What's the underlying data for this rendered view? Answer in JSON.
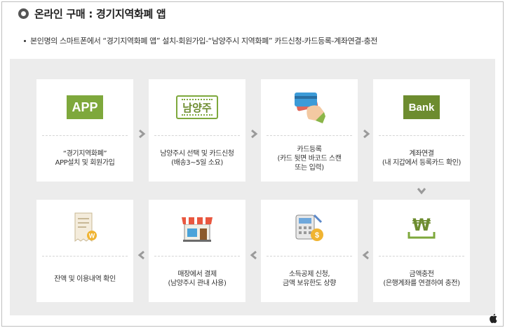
{
  "header": {
    "title": "온라인 구매 : 경기지역화폐 앱"
  },
  "description": "본인명의 스마트폰에서 “경기지역화폐 앱” 설치-회원가입-“남양주시 지역화폐” 카드신청-카드등록-계좌연결-충전",
  "icons": {
    "app_badge": "APP",
    "namyangju_badge": "남양주",
    "bank_badge": "Bank",
    "won_symbol": "₩",
    "coupon_w": "W",
    "coin_dollar": "$"
  },
  "steps": [
    {
      "lines": [
        "“경기지역화폐”",
        "APP설치 및 회원가입"
      ],
      "icon": "app-icon"
    },
    {
      "lines": [
        "남양주시 선택 및 카드신청",
        "(배송3~5일 소요)"
      ],
      "icon": "namyangju-icon"
    },
    {
      "lines": [
        "카드등록",
        "(카드 뒷면 바코드 스캔",
        "또는 입력)"
      ],
      "icon": "card-hand-icon"
    },
    {
      "lines": [
        "계좌연결",
        "(내 지갑에서 등록카드 확인)"
      ],
      "icon": "bank-icon"
    },
    {
      "lines": [
        "금액충전",
        "(은행계좌를 연결하여 충전)"
      ],
      "icon": "won-icon"
    },
    {
      "lines": [
        "소득공제 신청,",
        "금액 보유한도 상향"
      ],
      "icon": "calculator-coin-icon"
    },
    {
      "lines": [
        "매장에서 결제",
        "(남양주시 관내 사용)"
      ],
      "icon": "store-icon"
    },
    {
      "lines": [
        "잔액 및 이용내역 확인"
      ],
      "icon": "receipt-icon"
    }
  ],
  "colors": {
    "accent_green": "#7ea83c",
    "panel_bg": "#ececec",
    "arrow_gray": "#9a9a9a"
  }
}
